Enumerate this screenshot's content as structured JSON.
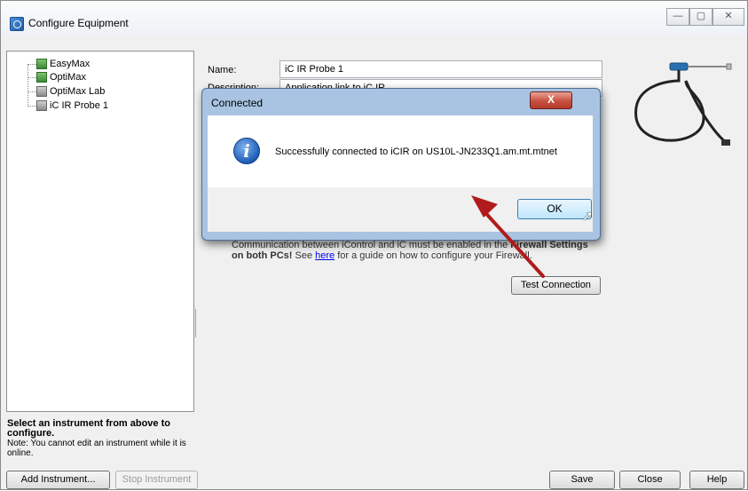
{
  "window": {
    "title": "Configure Equipment",
    "controls": {
      "minimize": "—",
      "maximize": "▢",
      "close": "✕"
    }
  },
  "tree": {
    "items": [
      {
        "label": "EasyMax",
        "icon": "instrument-icon"
      },
      {
        "label": "OptiMax",
        "icon": "instrument-icon"
      },
      {
        "label": "OptiMax Lab",
        "icon": "instrument-icon"
      },
      {
        "label": "iC IR Probe 1",
        "icon": "instrument-icon"
      }
    ]
  },
  "select_info": {
    "heading": "Select an instrument from above to configure.",
    "note": "Note: You cannot edit an instrument while it is online."
  },
  "form": {
    "name_label": "Name:",
    "name_value": "iC IR Probe 1",
    "description_label": "Description:",
    "description_value": "Application link to iC IR"
  },
  "firewall_note": {
    "line1_prefix": "Communication between iControl and iC must be enabled in the ",
    "line1_bold": "Firewall Settings",
    "line2_bold": "on both PCs!",
    "line2_text_a": " See ",
    "line2_link": "here",
    "line2_text_b": " for a guide on how to configure your Firewall."
  },
  "buttons": {
    "test_connection": "Test Connection",
    "add_instrument": "Add Instrument...",
    "stop_instrument": "Stop Instrument",
    "save": "Save",
    "close": "Close",
    "help": "Help"
  },
  "dialog": {
    "title": "Connected",
    "close_glyph": "X",
    "message": "Successfully connected to iCIR on US10L-JN233Q1.am.mt.mtnet",
    "ok": "OK",
    "info_glyph": "i"
  },
  "colors": {
    "arrow": "#b11b1b",
    "dialog_frame": "#a9c4e2",
    "ok_accent": "#3c7fb1"
  }
}
